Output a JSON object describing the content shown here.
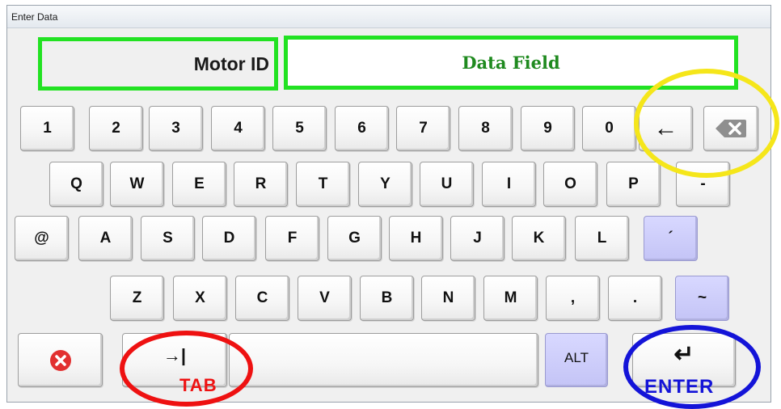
{
  "window": {
    "title": "Enter Data"
  },
  "fields": {
    "label": "Motor ID",
    "data_field": "Data Field"
  },
  "keys": {
    "row1": [
      "1",
      "2",
      "3",
      "4",
      "5",
      "6",
      "7",
      "8",
      "9",
      "0"
    ],
    "row2": [
      "Q",
      "W",
      "E",
      "R",
      "T",
      "Y",
      "U",
      "I",
      "O",
      "P",
      "-"
    ],
    "row3": [
      "@",
      "A",
      "S",
      "D",
      "F",
      "G",
      "H",
      "J",
      "K",
      "L",
      "´"
    ],
    "row4": [
      "Z",
      "X",
      "C",
      "V",
      "B",
      "N",
      "M",
      ",",
      ".",
      "~"
    ],
    "left_arrow": "←",
    "tab_symbol": "→|",
    "enter_symbol": "↵",
    "alt": "ALT"
  },
  "annotations": {
    "tab": "TAB",
    "enter": "ENTER"
  },
  "colors": {
    "field_border": "#22e222",
    "data_field_text": "#1f8a1f",
    "backspace_ring": "#f5e61a",
    "tab_ring": "#ee1111",
    "enter_ring": "#1414d8",
    "purple_key": "#c8c8f8",
    "cancel_icon": "#e23030"
  },
  "icons": {
    "backspace": "backspace-icon",
    "cancel": "cancel-icon"
  }
}
